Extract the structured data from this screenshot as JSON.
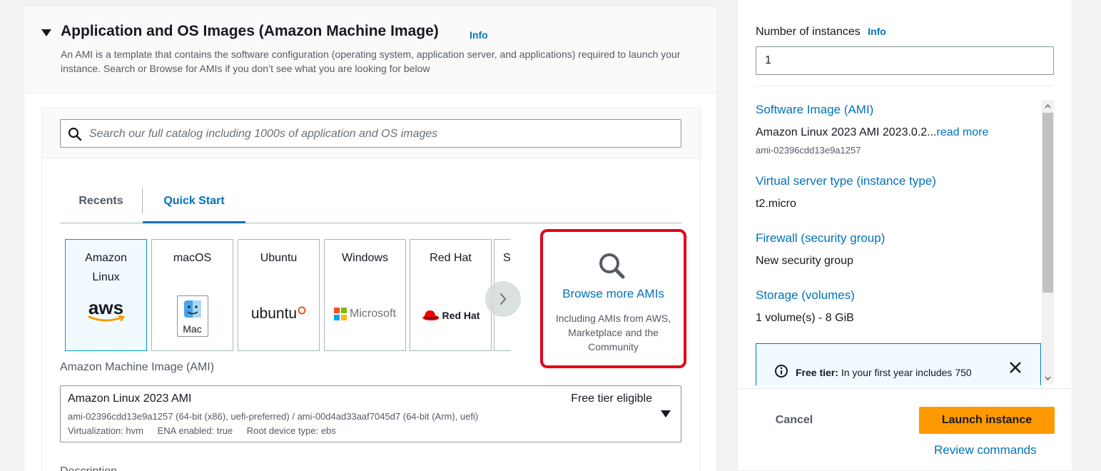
{
  "section": {
    "title": "Application and OS Images (Amazon Machine Image)",
    "info": "Info",
    "description": "An AMI is a template that contains the software configuration (operating system, application server, and applications) required to launch your instance. Search or Browse for AMIs if you don’t see what you are looking for below"
  },
  "search": {
    "placeholder": "Search our full catalog including 1000s of application and OS images"
  },
  "tabs": [
    {
      "label": "Recents"
    },
    {
      "label": "Quick Start"
    }
  ],
  "os_cards": [
    {
      "label": "Amazon Linux",
      "logo_text": "aws",
      "selected": true
    },
    {
      "label": "macOS",
      "logo_text": "Mac"
    },
    {
      "label": "Ubuntu",
      "logo_text": "ubuntu"
    },
    {
      "label": "Windows",
      "logo_text": "Microsoft"
    },
    {
      "label": "Red Hat",
      "logo_text": "Red Hat"
    },
    {
      "label": "S"
    }
  ],
  "browse": {
    "title": "Browse more AMIs",
    "subtitle": "Including AMIs from AWS, Marketplace and the Community"
  },
  "ami": {
    "label": "Amazon Machine Image (AMI)",
    "name": "Amazon Linux 2023 AMI",
    "badge": "Free tier eligible",
    "ids": "ami-02396cdd13e9a1257 (64-bit (x86), uefi-preferred) / ami-00d4ad33aaf7045d7 (64-bit (Arm), uefi)",
    "virtualization": "Virtualization: hvm",
    "ena": "ENA enabled: true",
    "root_device": "Root device type: ebs"
  },
  "description_label": "Description",
  "summary": {
    "instances_label": "Number of instances",
    "info": "Info",
    "instances_value": "1",
    "software_image_label": "Software Image (AMI)",
    "software_image_value": "Amazon Linux 2023 AMI 2023.0.2...",
    "read_more": "read more",
    "ami_id": "ami-02396cdd13e9a1257",
    "instance_type_label": "Virtual server type (instance type)",
    "instance_type_value": "t2.micro",
    "firewall_label": "Firewall (security group)",
    "firewall_value": "New security group",
    "storage_label": "Storage (volumes)",
    "storage_value": "1 volume(s) - 8 GiB",
    "free_tier_bold": "Free tier:",
    "free_tier_text": "In your first year includes 750"
  },
  "actions": {
    "cancel": "Cancel",
    "launch": "Launch instance",
    "review": "Review commands"
  },
  "colors": {
    "accent_blue": "#0073bb",
    "launch_orange": "#ff9900",
    "highlight_red": "#e3001b"
  }
}
